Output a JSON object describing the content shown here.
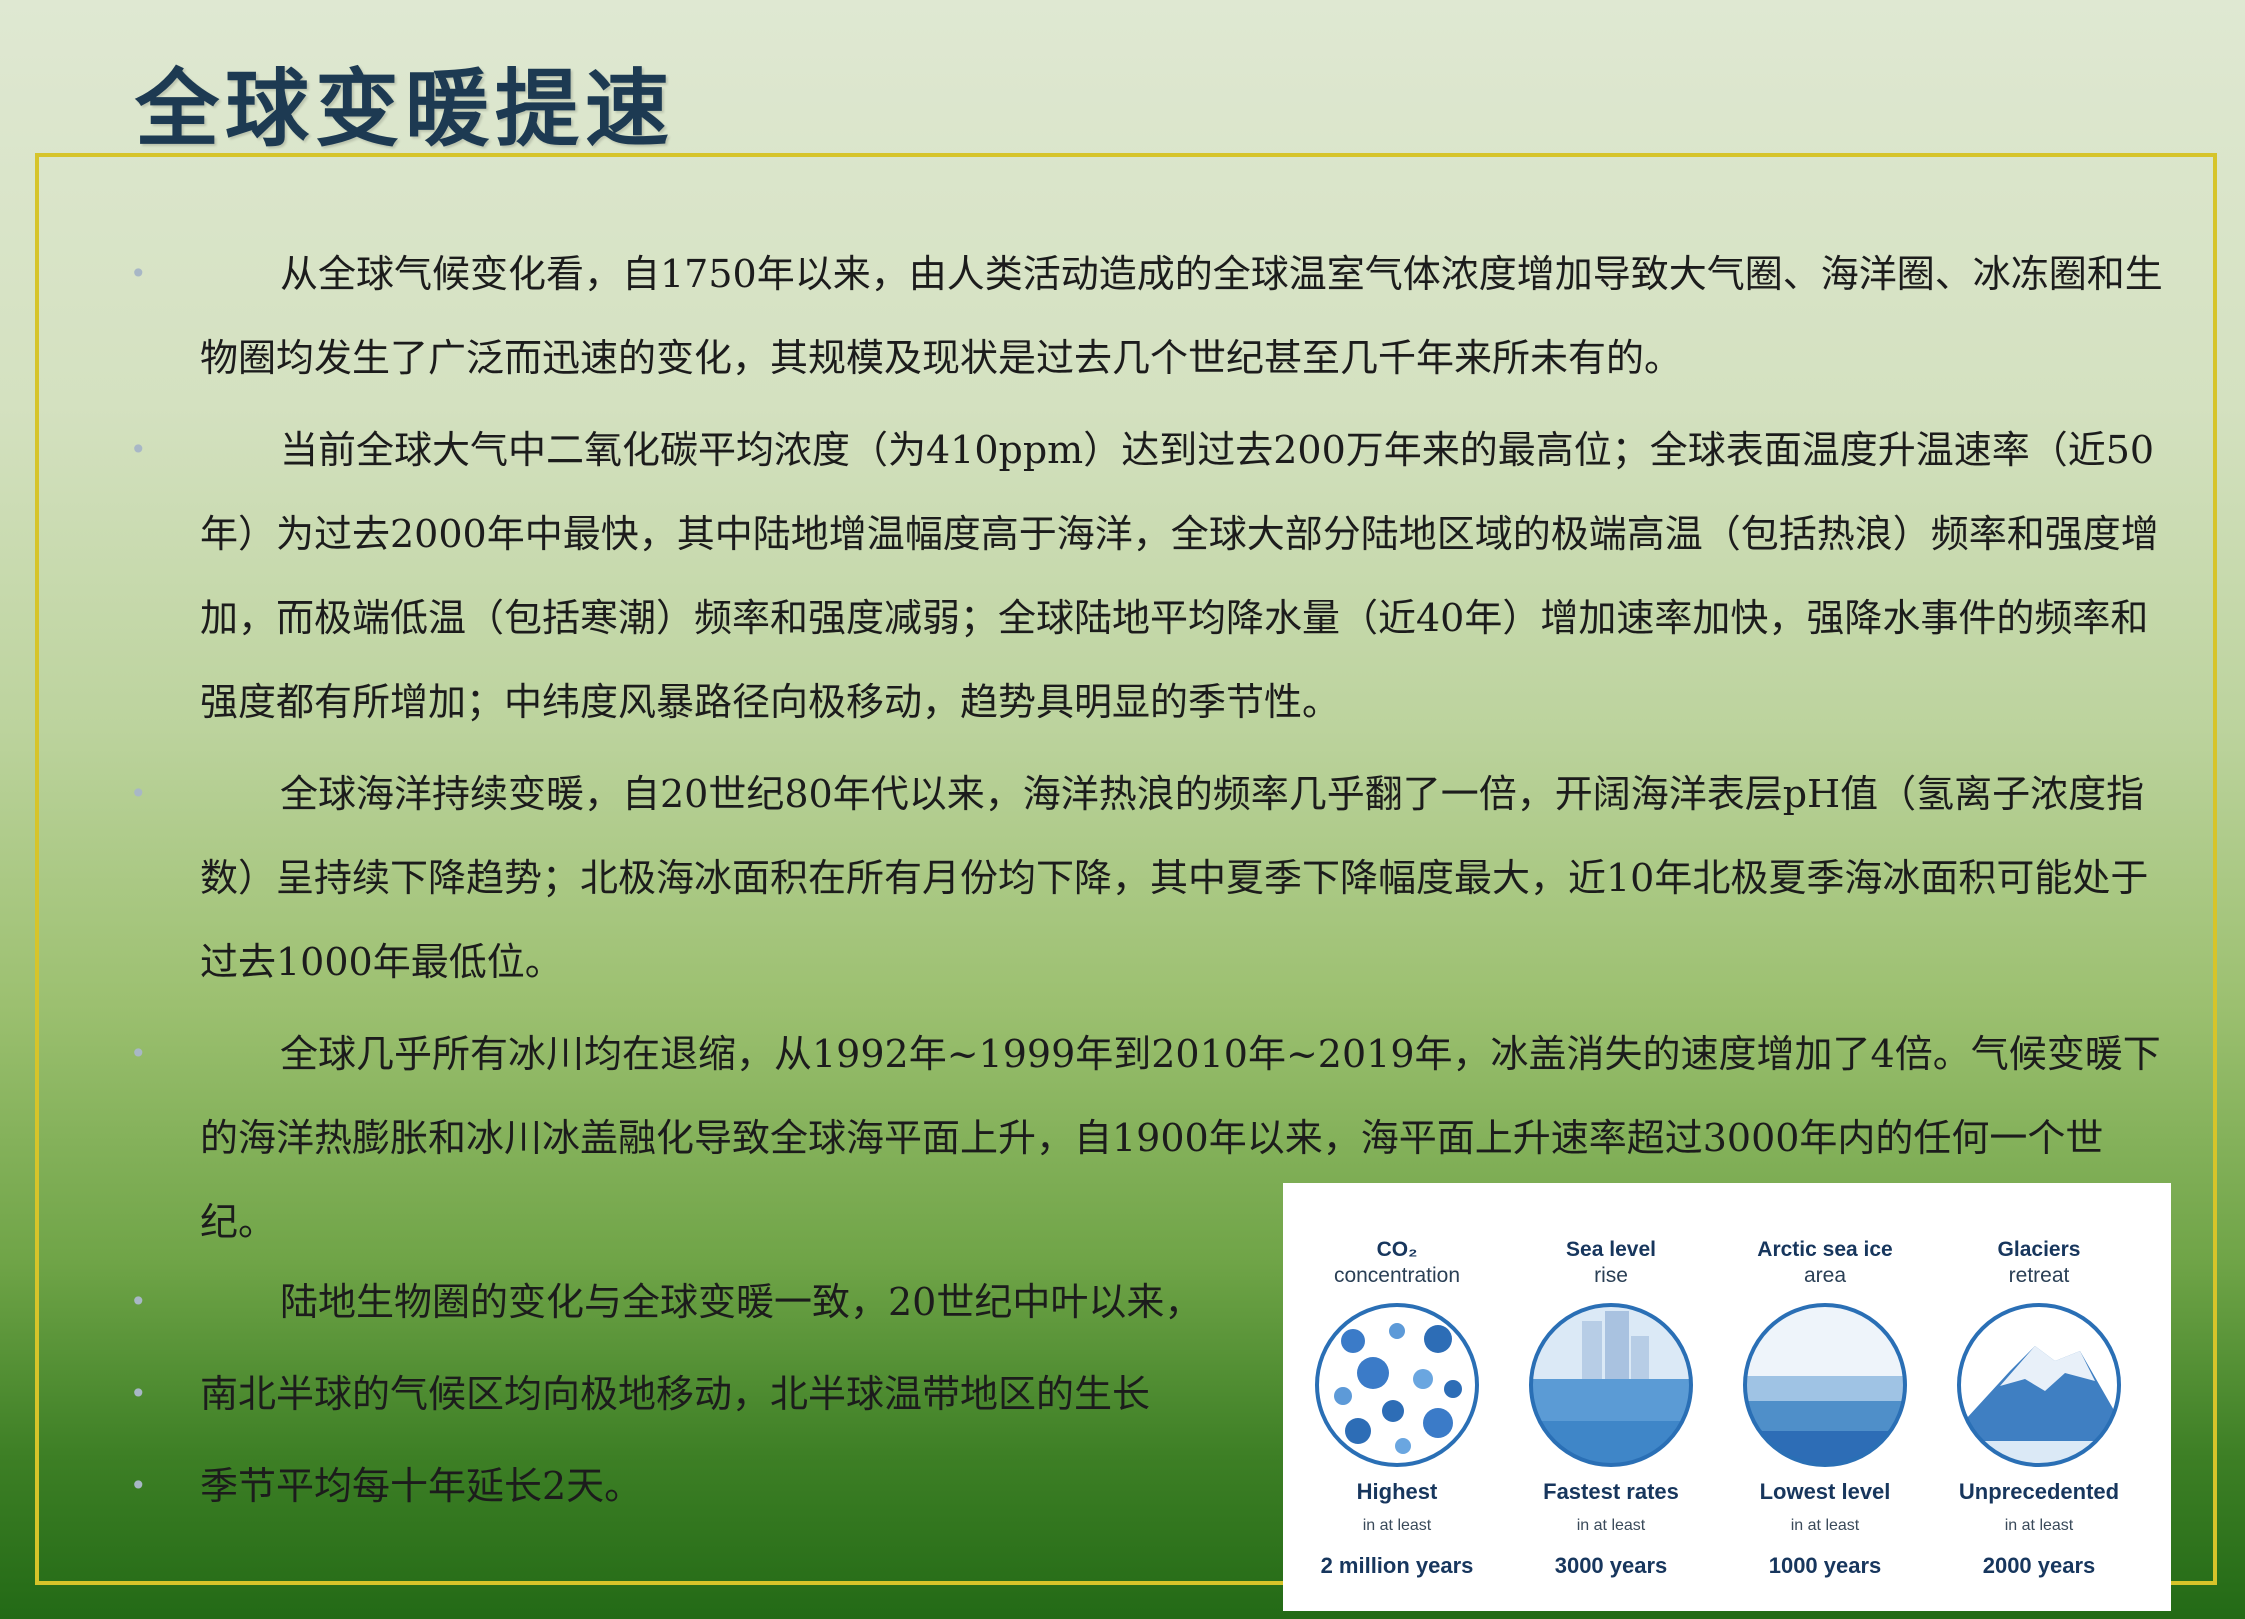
{
  "title": "全球变暖提速",
  "paragraphs": [
    "从全球气候变化看，自1750年以来，由人类活动造成的全球温室气体浓度增加导致大气圈、海洋圈、冰冻圈和生物圈均发生了广泛而迅速的变化，其规模及现状是过去几个世纪甚至几千年来所未有的。",
    "当前全球大气中二氧化碳平均浓度（为410ppm）达到过去200万年来的最高位；全球表面温度升温速率（近50年）为过去2000年中最快，其中陆地增温幅度高于海洋，全球大部分陆地区域的极端高温（包括热浪）频率和强度增加，而极端低温（包括寒潮）频率和强度减弱；全球陆地平均降水量（近40年）增加速率加快，强降水事件的频率和强度都有所增加；中纬度风暴路径向极移动，趋势具明显的季节性。",
    "全球海洋持续变暖，自20世纪80年代以来，海洋热浪的频率几乎翻了一倍，开阔海洋表层pH值（氢离子浓度指数）呈持续下降趋势；北极海冰面积在所有月份均下降，其中夏季下降幅度最大，近10年北极夏季海冰面积可能处于过去1000年最低位。",
    "全球几乎所有冰川均在退缩，从1992年~1999年到2010年~2019年，冰盖消失的速度增加了4倍。气候变暖下的海洋热膨胀和冰川冰盖融化导致全球海平面上升，自1900年以来，海平面上升速率超过3000年内的任何一个世纪。"
  ],
  "bottom_lines": [
    "陆地生物圈的变化与全球变暖一致，20世纪中叶以来，",
    "南北半球的气候区均向极地移动，北半球温带地区的生长",
    "季节平均每十年延长2天。"
  ],
  "infographic": {
    "items": [
      {
        "head": "CO₂",
        "sub": "concentration",
        "label": "Highest",
        "in_at_least": "in at least",
        "years": "2 million years",
        "icon": "co2-bubbles-icon"
      },
      {
        "head": "Sea level",
        "sub": "rise",
        "label": "Fastest rates",
        "in_at_least": "in at least",
        "years": "3000 years",
        "icon": "sea-level-icon"
      },
      {
        "head": "Arctic sea ice",
        "sub": "area",
        "label": "Lowest level",
        "in_at_least": "in at least",
        "years": "1000 years",
        "icon": "sea-ice-icon"
      },
      {
        "head": "Glaciers",
        "sub": "retreat",
        "label": "Unprecedented",
        "in_at_least": "in at least",
        "years": "2000 years",
        "icon": "glacier-icon"
      }
    ]
  },
  "colors": {
    "title": "#1d3a52",
    "frame": "#d6c42a",
    "infographic_text": "#17365d"
  }
}
